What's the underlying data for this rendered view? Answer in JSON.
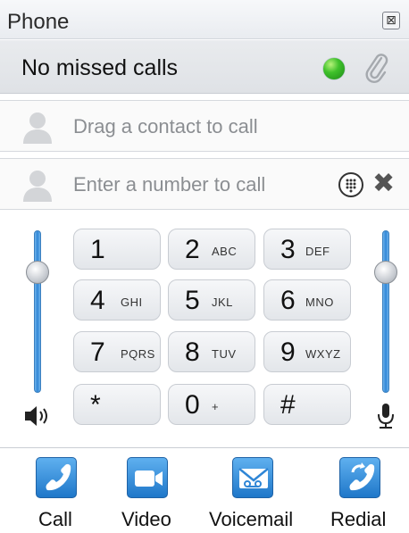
{
  "window": {
    "title": "Phone",
    "close_glyph": "⊠"
  },
  "status": {
    "text": "No missed calls",
    "indicator_color": "#3fc12b"
  },
  "contact_field": {
    "placeholder": "Drag a contact to call"
  },
  "number_field": {
    "placeholder": "Enter a number to call",
    "clear_glyph": "✖"
  },
  "volume": {
    "speaker_level": 0.78,
    "mic_level": 0.78
  },
  "keypad": {
    "keys": [
      {
        "num": "1",
        "letters": ""
      },
      {
        "num": "2",
        "letters": "ABC"
      },
      {
        "num": "3",
        "letters": "DEF"
      },
      {
        "num": "4",
        "letters": "GHI"
      },
      {
        "num": "5",
        "letters": "JKL"
      },
      {
        "num": "6",
        "letters": "MNO"
      },
      {
        "num": "7",
        "letters": "PQRS"
      },
      {
        "num": "8",
        "letters": "TUV"
      },
      {
        "num": "9",
        "letters": "WXYZ"
      },
      {
        "num": "*",
        "letters": ""
      },
      {
        "num": "0",
        "letters": "+"
      },
      {
        "num": "#",
        "letters": ""
      }
    ]
  },
  "actions": [
    {
      "label": "Call",
      "icon": "phone-icon"
    },
    {
      "label": "Video",
      "icon": "video-camera-icon"
    },
    {
      "label": "Voicemail",
      "icon": "voicemail-envelope-icon"
    },
    {
      "label": "Redial",
      "icon": "redial-icon"
    }
  ],
  "colors": {
    "accent": "#2f86d6",
    "status_green": "#3fc12b"
  }
}
